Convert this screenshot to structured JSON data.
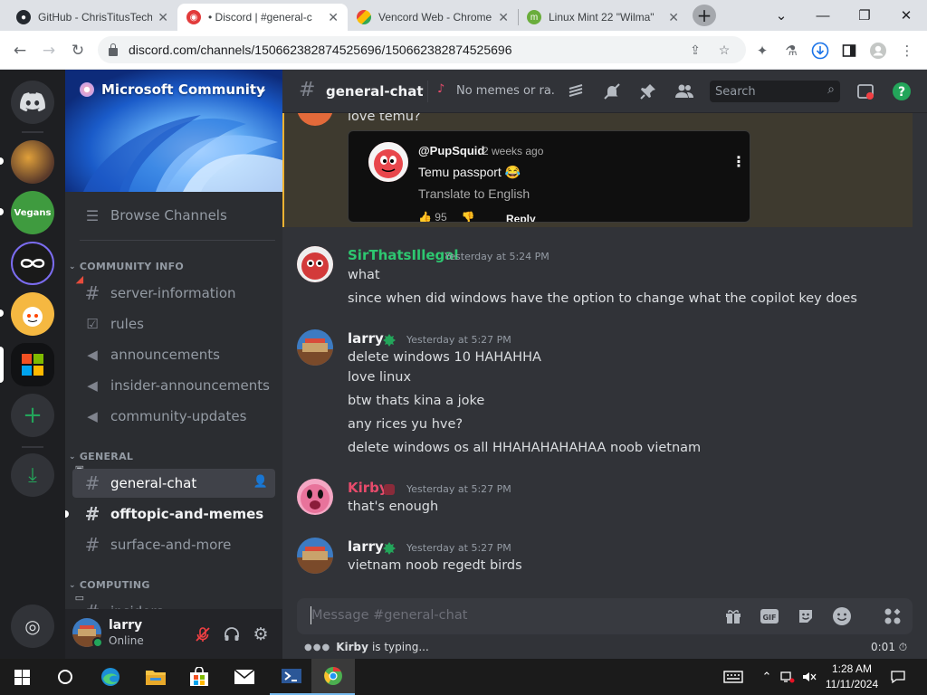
{
  "browser": {
    "tabs": [
      {
        "title": "GitHub - ChrisTitusTech",
        "active": false
      },
      {
        "title": "• Discord | #general-c",
        "active": true
      },
      {
        "title": "Vencord Web - Chrome",
        "active": false
      },
      {
        "title": "Linux Mint 22 \"Wilma\"",
        "active": false
      }
    ],
    "url": "discord.com/channels/1506623828745256​96/1506623828745256​96"
  },
  "discord": {
    "server_name": "Microsoft Community",
    "browse_channels": "Browse Channels",
    "categories": {
      "community_info": "COMMUNITY INFO",
      "general": "GENERAL",
      "computing": "COMPUTING"
    },
    "channels": {
      "server_information": "server-information",
      "rules": "rules",
      "announcements": "announcements",
      "insider_announcements": "insider-announcements",
      "community_updates": "community-updates",
      "general_chat": "general-chat",
      "offtopic_and_memes": "offtopic-and-memes",
      "surface_and_more": "surface-and-more",
      "insiders": "insiders"
    },
    "user_panel": {
      "username": "larry",
      "status": "Online"
    },
    "header": {
      "channel": "general-chat",
      "topic": "No memes or ra...",
      "search_placeholder": "Search"
    },
    "messages": {
      "partial_text": "love temu?",
      "embed": {
        "author": "@PupSquid",
        "time": "2 weeks ago",
        "text": "Temu passport 😂",
        "translate": "Translate to English",
        "likes": "95",
        "reply": "Reply"
      },
      "groups": [
        {
          "author": "SirThatsIllegal",
          "color": "#2dc770",
          "timestamp": "Yesterday at 5:24 PM",
          "lines": [
            "what",
            "since when did windows have the option to change what the copilot key does"
          ]
        },
        {
          "author": "larry",
          "color": "#f2f3f5",
          "timestamp": "Yesterday at 5:27 PM",
          "lines": [
            "delete windows 10 HAHAHHA",
            "love linux",
            "btw thats kina a joke",
            "any rices yu hve?",
            "delete windows os all HHAHAHAHAHAA noob vietnam"
          ]
        },
        {
          "author": "Kirby",
          "color": "#e74b6b",
          "timestamp": "Yesterday at 5:27 PM",
          "lines": [
            "that's enough"
          ]
        },
        {
          "author": "larry",
          "color": "#f2f3f5",
          "timestamp": "Yesterday at 5:27 PM",
          "lines": [
            "vietnam noob regedt birds"
          ]
        }
      ]
    },
    "composer_placeholder": "Message #general-chat",
    "typing": {
      "user": "Kirby",
      "suffix": "is typing...",
      "timer": "0:01"
    }
  },
  "taskbar": {
    "time": "1:28 AM",
    "date": "11/11/2024"
  },
  "colors": {
    "discord_bg": "#313338",
    "sidebar_bg": "#2b2d31",
    "guild_bg": "#1e1f22",
    "green": "#23a55a",
    "highlight": "#f0b232"
  },
  "icons": [
    "github-icon",
    "discord-icon",
    "vencord-icon",
    "linuxmint-icon",
    "lock-icon",
    "share-icon",
    "star-icon",
    "puzzle-icon",
    "download-icon",
    "sidepanel-icon",
    "profile-icon",
    "kebab-icon",
    "threads-icon",
    "mute-icon",
    "pin-icon",
    "members-icon",
    "inbox-icon",
    "help-icon",
    "gift-icon",
    "gif-icon",
    "sticker-icon",
    "emoji-icon",
    "apps-icon",
    "mic-muted-icon",
    "headphones-icon",
    "gear-icon",
    "windows-start-icon",
    "search-circle-icon",
    "edge-icon",
    "explorer-icon",
    "store-icon",
    "mail-icon",
    "terminal-icon"
  ]
}
